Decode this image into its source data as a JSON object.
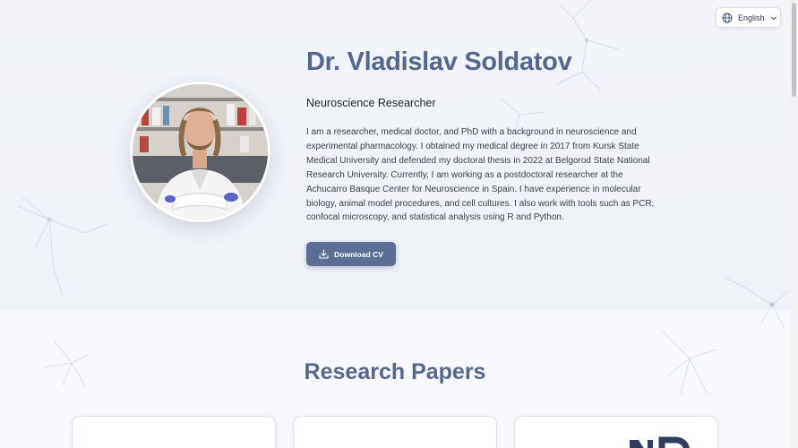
{
  "language": {
    "label": "English",
    "icon": "globe-icon"
  },
  "profile": {
    "name": "Dr. Vladislav Soldatov",
    "title": "Neuroscience Researcher",
    "bio": "I am a researcher, medical doctor, and PhD with a background in neuroscience and experimental pharmacology. I obtained my medical degree in 2017 from Kursk State Medical University and defended my doctoral thesis in 2022 at Belgorod State National Research University. Currently, I am working as a postdoctoral researcher at the Achucarro Basque Center for Neuroscience in Spain. I have experience in molecular biology, animal model procedures, and cell cultures. I also work with tools such as PCR, confocal microscopy, and statistical analysis using R and Python.",
    "download_label": "Download CV",
    "download_icon": "download-icon"
  },
  "papers": {
    "heading": "Research Papers",
    "cards": [
      {},
      {},
      {}
    ]
  },
  "colors": {
    "accent": "#54688f",
    "button": "#5a6e96",
    "background": "#f3f5f9"
  }
}
